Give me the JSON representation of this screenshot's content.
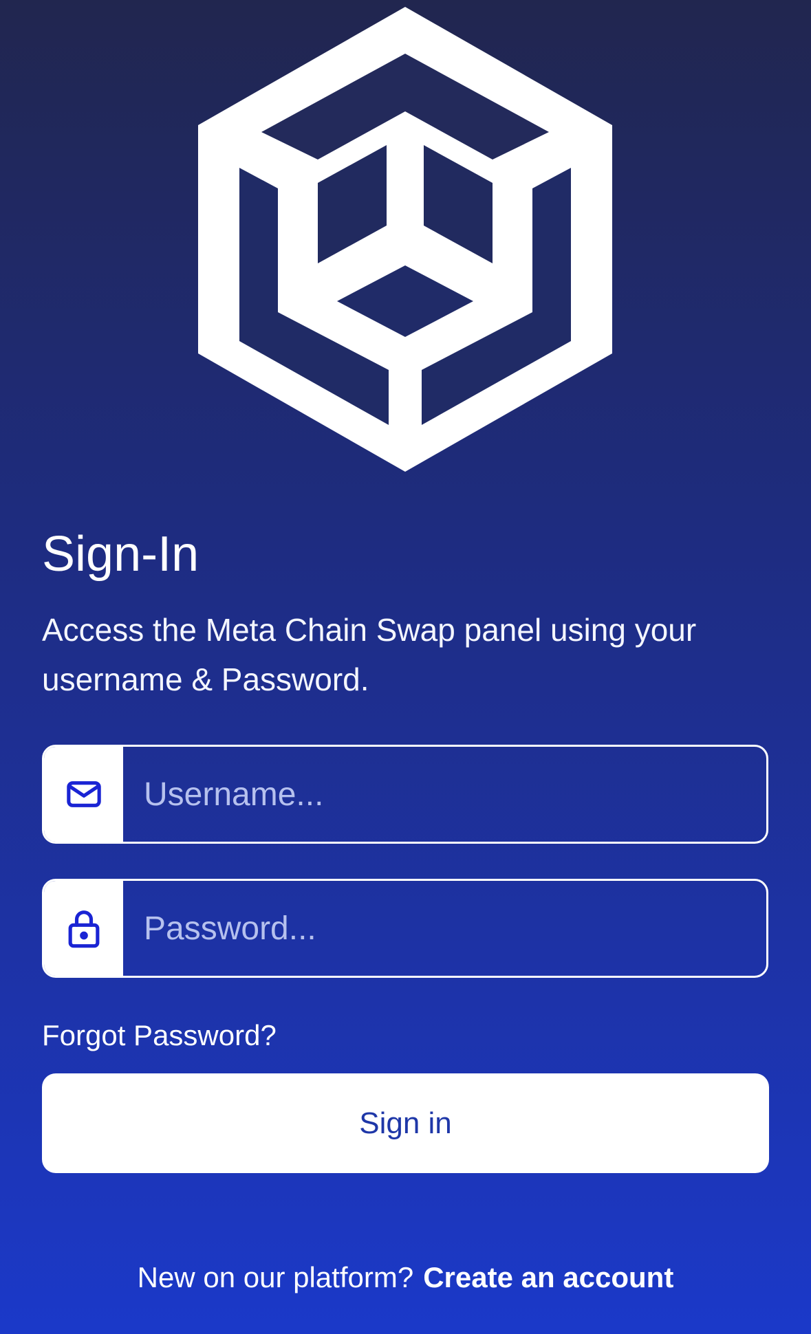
{
  "logo": {
    "name": "cube-logo-icon"
  },
  "title": "Sign-In",
  "subtitle": "Access the Meta Chain Swap panel using your username & Password.",
  "username": {
    "placeholder": "Username...",
    "value": "",
    "icon": "mail-icon"
  },
  "password": {
    "placeholder": "Password...",
    "value": "",
    "icon": "lock-icon"
  },
  "forgot_label": "Forgot Password?",
  "signin_label": "Sign in",
  "footer": {
    "prompt": "New on our platform?",
    "create_label": "Create an account"
  },
  "colors": {
    "accent": "#1e37a8",
    "icon": "#1a24d4",
    "placeholder": "#b6c1ee"
  }
}
